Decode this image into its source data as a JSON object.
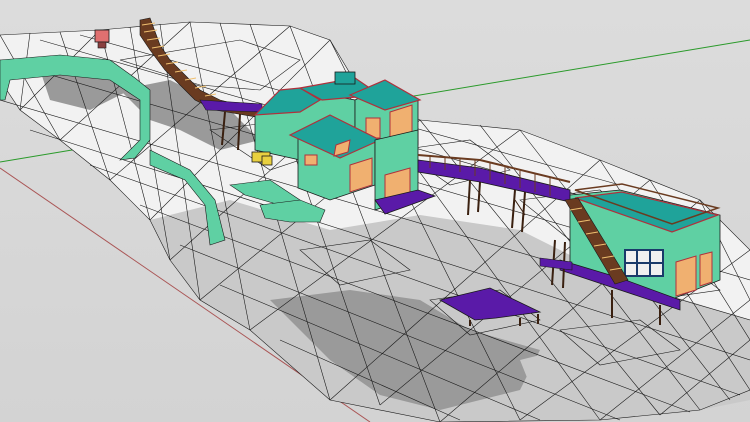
{
  "colors": {
    "background": "#d6d6d6",
    "terrain_light": "#f2f2f2",
    "terrain_mid": "#c8c8c8",
    "terrain_dark": "#9c9c9c",
    "mesh_line": "#1a1a1a",
    "roof_teal": "#1fa39a",
    "wall_green": "#5fd0a3",
    "trim_red": "#b0313c",
    "window_orange": "#f0b070",
    "deck_purple": "#5a1aa8",
    "stair_brown": "#6a3b20",
    "axis_red": "#a85555",
    "axis_green": "#2a9a2a"
  },
  "icons": {
    "model": "sketchup-3d-model",
    "axis_red": "red-axis-line",
    "axis_green": "green-axis-line"
  }
}
